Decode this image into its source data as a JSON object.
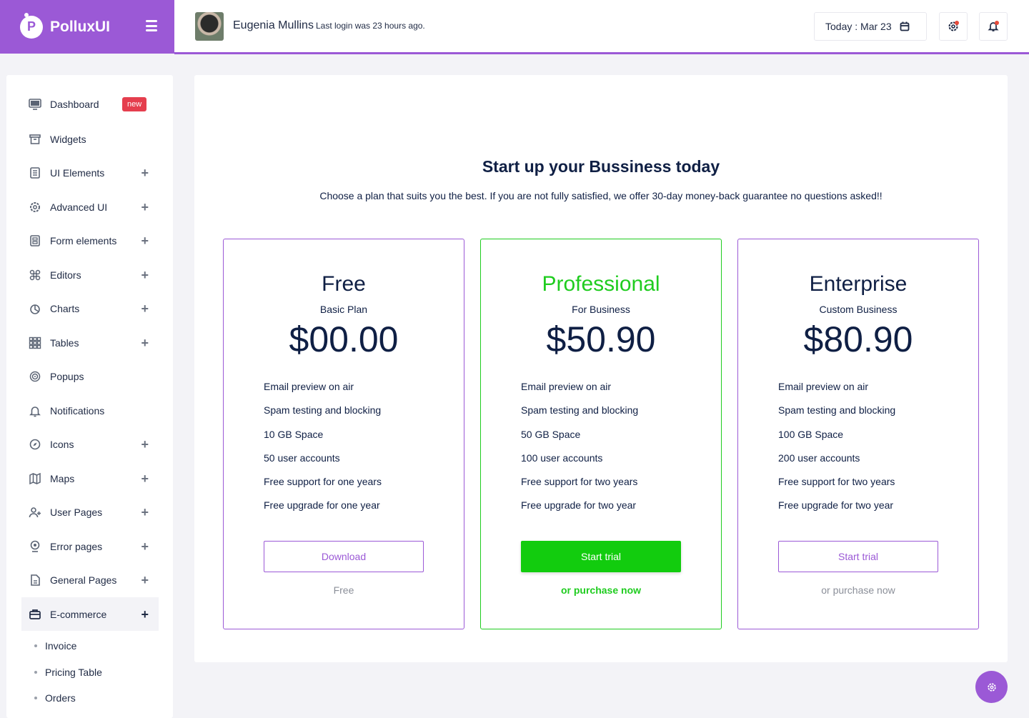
{
  "brand": {
    "name": "PolluxUI",
    "logo_letter": "P"
  },
  "header": {
    "user_name": "Eugenia Mullins",
    "last_login": "Last login was 23 hours ago.",
    "date": "Today : Mar 23"
  },
  "sidebar": {
    "items": [
      {
        "label": "Dashboard",
        "icon": "monitor-icon",
        "badge": "new"
      },
      {
        "label": "Widgets",
        "icon": "archive-icon"
      },
      {
        "label": "UI Elements",
        "icon": "document-icon",
        "expandable": true
      },
      {
        "label": "Advanced UI",
        "icon": "gear-icon",
        "expandable": true
      },
      {
        "label": "Form elements",
        "icon": "form-icon",
        "expandable": true
      },
      {
        "label": "Editors",
        "icon": "command-icon",
        "expandable": true
      },
      {
        "label": "Charts",
        "icon": "pie-chart-icon",
        "expandable": true
      },
      {
        "label": "Tables",
        "icon": "grid-icon",
        "expandable": true
      },
      {
        "label": "Popups",
        "icon": "target-icon"
      },
      {
        "label": "Notifications",
        "icon": "bell-icon"
      },
      {
        "label": "Icons",
        "icon": "compass-icon",
        "expandable": true
      },
      {
        "label": "Maps",
        "icon": "map-icon",
        "expandable": true
      },
      {
        "label": "User Pages",
        "icon": "user-plus-icon",
        "expandable": true
      },
      {
        "label": "Error pages",
        "icon": "alert-icon",
        "expandable": true
      },
      {
        "label": "General Pages",
        "icon": "file-icon",
        "expandable": true
      },
      {
        "label": "E-commerce",
        "icon": "cart-icon",
        "expandable": true,
        "active": true
      }
    ],
    "sub_items": [
      "Invoice",
      "Pricing Table",
      "Orders"
    ]
  },
  "main": {
    "title": "Start up your Bussiness today",
    "subtitle": "Choose a plan that suits you the best. If you are not fully satisfied, we offer 30-day money-back guarantee no questions asked!!",
    "plans": [
      {
        "name": "Free",
        "tagline": "Basic Plan",
        "price": "$00.00",
        "features": [
          "Email preview on air",
          "Spam testing and blocking",
          "10 GB Space",
          "50 user accounts",
          "Free support for one years",
          "Free upgrade for one year"
        ],
        "button": "Download",
        "note": "Free"
      },
      {
        "name": "Professional",
        "tagline": "For Business",
        "price": "$50.90",
        "features": [
          "Email preview on air",
          "Spam testing and blocking",
          "50 GB Space",
          "100 user accounts",
          "Free support for two years",
          "Free upgrade for two year"
        ],
        "button": "Start trial",
        "note": "or purchase now"
      },
      {
        "name": "Enterprise",
        "tagline": "Custom Business",
        "price": "$80.90",
        "features": [
          "Email preview on air",
          "Spam testing and blocking",
          "100 GB Space",
          "200 user accounts",
          "Free support for two years",
          "Free upgrade for two year"
        ],
        "button": "Start trial",
        "note": "or purchase now"
      }
    ]
  },
  "colors": {
    "accent": "#9b59d6",
    "success": "#12cc0e",
    "badge": "#e53e4e",
    "text": "#0f1f44"
  }
}
